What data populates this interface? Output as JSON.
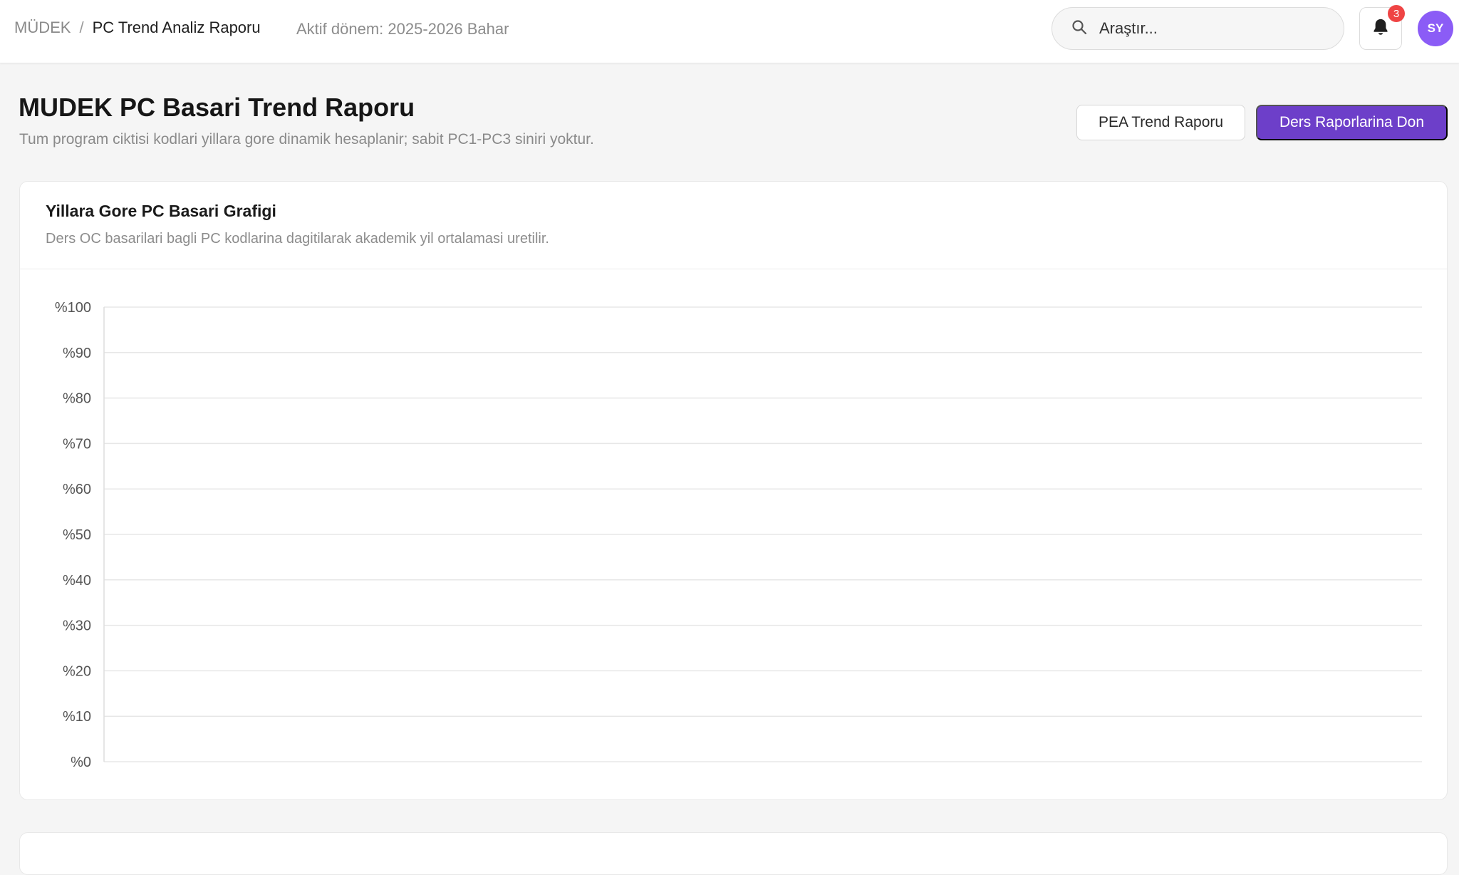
{
  "breadcrumb": {
    "root": "MÜDEK",
    "separator": "/",
    "current": "PC Trend Analiz Raporu"
  },
  "header": {
    "active_period": "Aktif dönem: 2025-2026 Bahar"
  },
  "search": {
    "placeholder": "Araştır..."
  },
  "notifications": {
    "count": "3"
  },
  "user": {
    "initials": "SY"
  },
  "page": {
    "title": "MUDEK PC Basari Trend Raporu",
    "subtitle": "Tum program ciktisi kodlari yillara gore dinamik hesaplanir; sabit PC1-PC3 siniri yoktur."
  },
  "actions": {
    "pea_trend": "PEA Trend Raporu",
    "back_to_reports": "Ders Raporlarina Don"
  },
  "card": {
    "title": "Yillara Gore PC Basari Grafigi",
    "subtitle": "Ders OC basarilari bagli PC kodlarina dagitilarak akademik yil ortalamasi uretilir."
  },
  "colors": {
    "accent": "#6d3fc9",
    "badge": "#ef4444",
    "avatar": "#8b5cf6"
  },
  "chart_data": {
    "type": "line",
    "title": "",
    "xlabel": "",
    "ylabel": "",
    "x": [],
    "series": [],
    "ylim": [
      0,
      100
    ],
    "yticks": [
      100,
      90,
      80,
      70,
      60,
      50,
      40,
      30,
      20,
      10,
      0
    ],
    "ytick_labels": [
      "%100",
      "%90",
      "%80",
      "%70",
      "%60",
      "%50",
      "%40",
      "%30",
      "%20",
      "%10",
      "%0"
    ],
    "grid": true
  }
}
